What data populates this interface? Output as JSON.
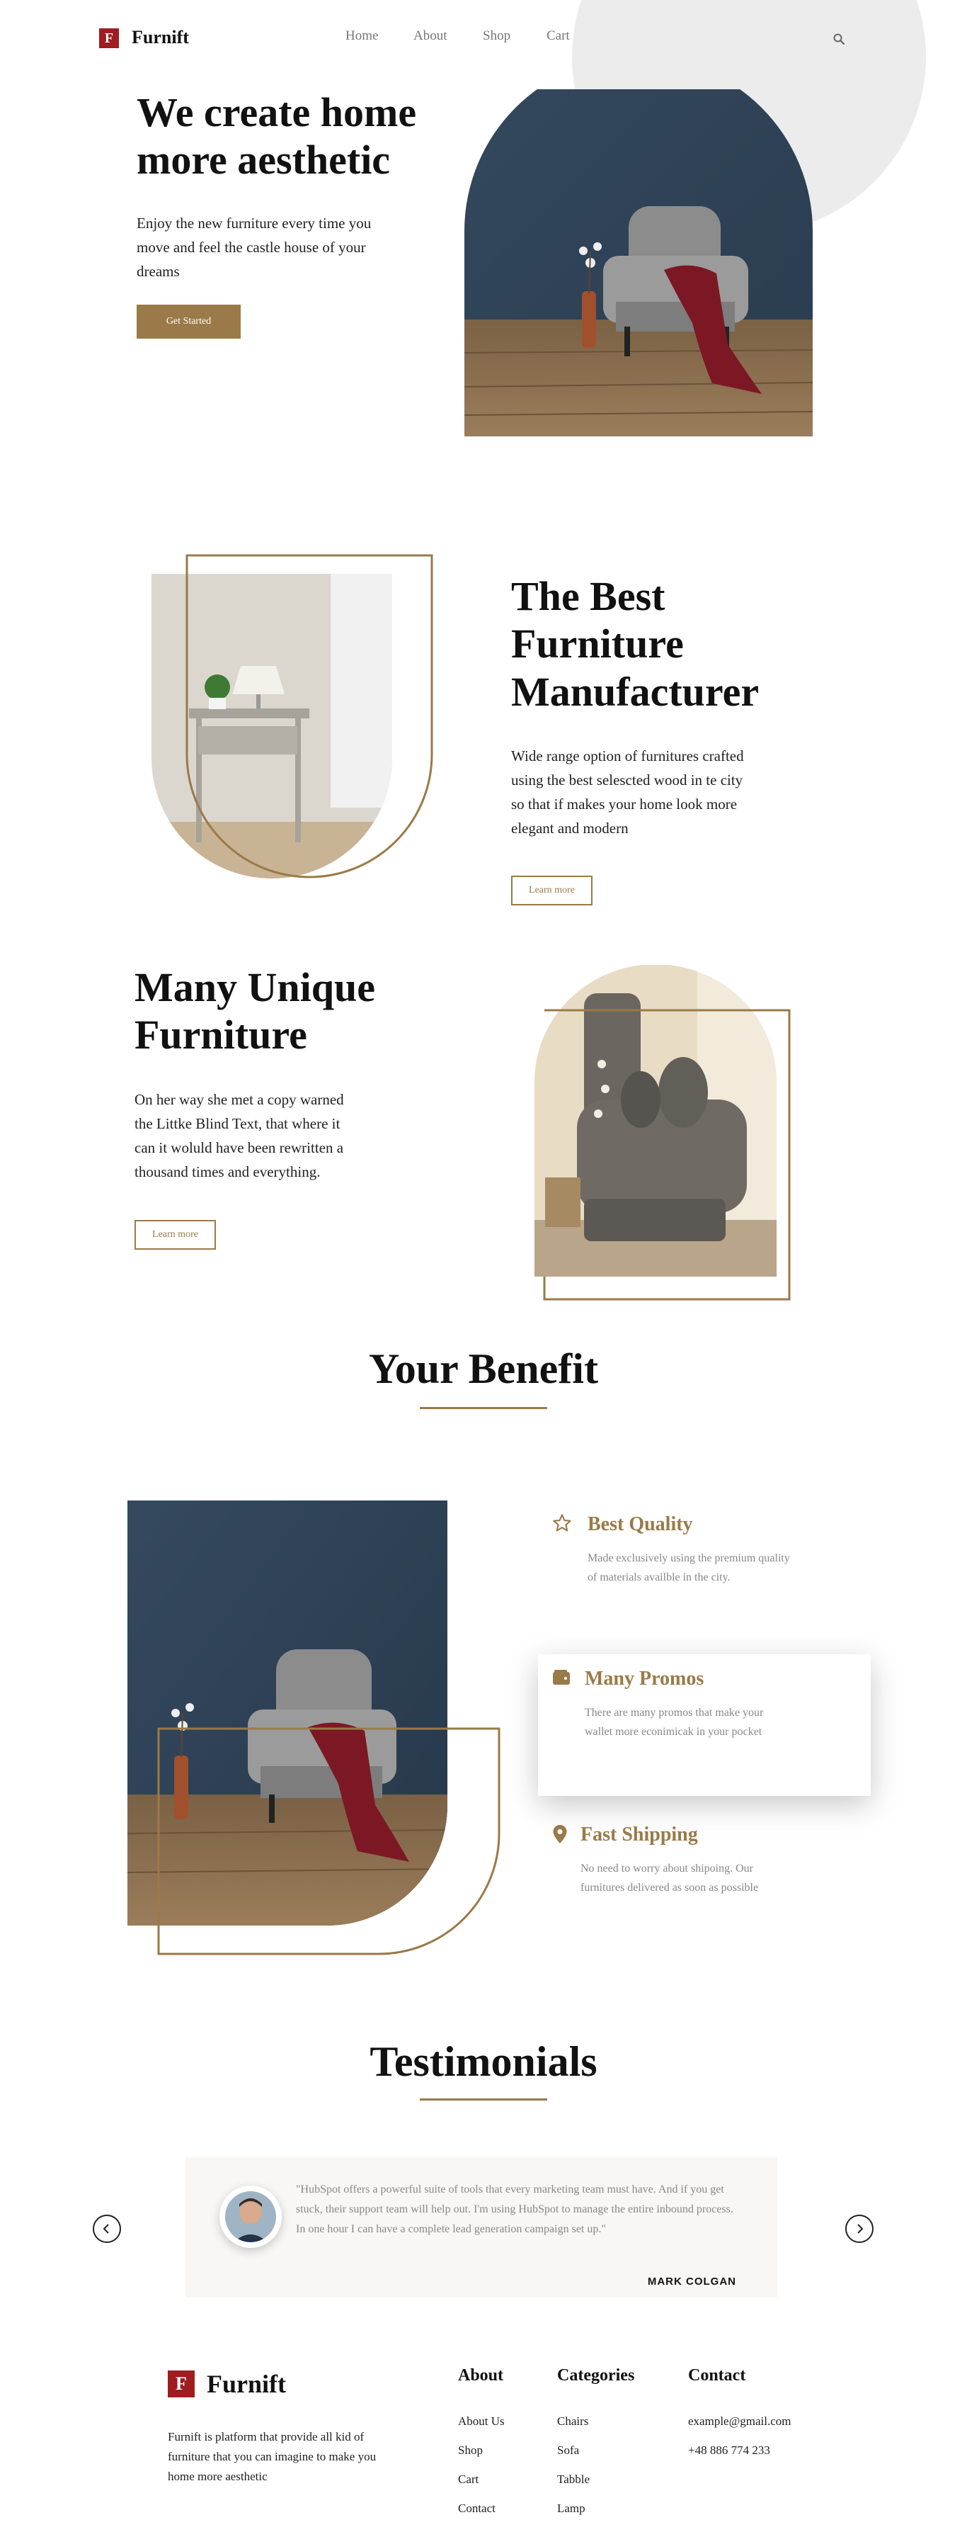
{
  "brand": {
    "logo_letter": "F",
    "name": "Furnift",
    "color": "#a01c21",
    "accent": "#9a7a48"
  },
  "nav": {
    "items": [
      "Home",
      "About",
      "Shop",
      "Cart"
    ],
    "search_icon": "search-icon"
  },
  "hero": {
    "title_line1": "We create home",
    "title_line2": "more aesthetic",
    "text": "Enjoy the new furniture every time you move and feel the castle house of your dreams",
    "button": "Get Started"
  },
  "manufacturer": {
    "title_line1": "The Best",
    "title_line2": "Furniture",
    "title_line3": "Manufacturer",
    "text": "Wide range option of furnitures crafted using the best selescted wood in te city so that if makes your home look more elegant and modern",
    "button": "Learn more"
  },
  "unique": {
    "title_line1": "Many Unique",
    "title_line2": "Furniture",
    "text": "On her way she met a copy warned the Littke Blind Text, that where it can it woluld have been rewritten a thousand times and everything.",
    "button": "Learn more"
  },
  "benefit": {
    "title": "Your Benefit",
    "items": [
      {
        "icon": "star-icon",
        "title": "Best Quality",
        "desc": "Made exclusively using the premium quality of materials availble in the city."
      },
      {
        "icon": "wallet-icon",
        "title": "Many Promos",
        "desc": "There are many promos that make your wallet more econimicak in your pocket"
      },
      {
        "icon": "location-pin-icon",
        "title": "Fast Shipping",
        "desc": "No need to worry about shipoing. Our furnitures delivered as soon as possible"
      }
    ]
  },
  "testimonials": {
    "title": "Testimonials",
    "quote": "\"HubSpot offers a powerful suite of tools that every marketing team must have. And if you get stuck, their support team will help out. I'm using HubSpot to manage the entire inbound process. In one hour I can have a complete lead generation campaign set up.\"",
    "name": "MARK COLGAN",
    "prev_icon": "chevron-left-icon",
    "next_icon": "chevron-right-icon"
  },
  "footer": {
    "brand_name": "Furnift",
    "description": "Furnift is platform that provide all kid of furniture that you can imagine to make you home more aesthetic",
    "about": {
      "heading": "About",
      "links": [
        "About Us",
        "Shop",
        "Cart",
        "Contact"
      ]
    },
    "categories": {
      "heading": "Categories",
      "links": [
        "Chairs",
        "Sofa",
        "Tabble",
        "Lamp"
      ]
    },
    "contact": {
      "heading": "Contact",
      "email": "example@gmail.com",
      "phone": "+48 886 774 233"
    }
  }
}
